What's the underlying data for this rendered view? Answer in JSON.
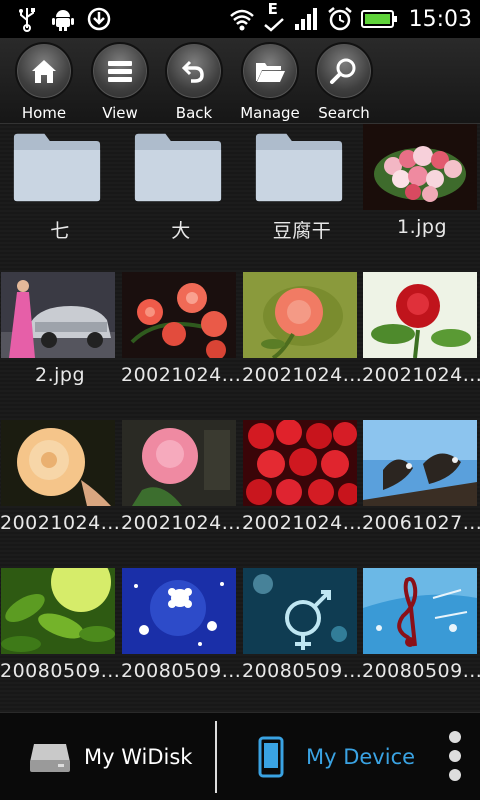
{
  "status_bar": {
    "time": "15:03",
    "network_letter": "E",
    "icons": [
      "usb-icon",
      "android-debug-icon",
      "download-icon",
      "wifi-icon",
      "signal-icon",
      "alarm-icon",
      "battery-icon"
    ]
  },
  "toolbar": {
    "buttons": [
      {
        "label": "Home",
        "icon": "home-icon"
      },
      {
        "label": "View",
        "icon": "list-view-icon"
      },
      {
        "label": "Back",
        "icon": "back-arrow-icon"
      },
      {
        "label": "Manage",
        "icon": "folder-open-icon"
      },
      {
        "label": "Search",
        "icon": "magnifier-icon"
      }
    ]
  },
  "items": [
    {
      "name": "七",
      "type": "folder"
    },
    {
      "name": "大",
      "type": "folder"
    },
    {
      "name": "豆腐干",
      "type": "folder"
    },
    {
      "name": "1.jpg",
      "type": "image",
      "thumb": "flower-bouquet"
    },
    {
      "name": "2.jpg",
      "type": "image",
      "thumb": "car-model"
    },
    {
      "name": "20021024...",
      "type": "image",
      "thumb": "red-roses"
    },
    {
      "name": "20021024...",
      "type": "image",
      "thumb": "pink-rose"
    },
    {
      "name": "20021024...",
      "type": "image",
      "thumb": "red-rose-single"
    },
    {
      "name": "20021024...",
      "type": "image",
      "thumb": "yellow-rose"
    },
    {
      "name": "20021024...",
      "type": "image",
      "thumb": "pink-rose-2"
    },
    {
      "name": "20021024...",
      "type": "image",
      "thumb": "red-roses-bunch"
    },
    {
      "name": "20061027...",
      "type": "image",
      "thumb": "eagles"
    },
    {
      "name": "20080509...",
      "type": "image",
      "thumb": "green-leaves"
    },
    {
      "name": "20080509...",
      "type": "image",
      "thumb": "blue-snowflakes"
    },
    {
      "name": "20080509...",
      "type": "image",
      "thumb": "symbol-swirl"
    },
    {
      "name": "20080509...",
      "type": "image",
      "thumb": "music-note"
    }
  ],
  "bottom_bar": {
    "left_label": "My WiDisk",
    "right_label": "My Device",
    "active": "My Device",
    "active_color": "#3aa3e3"
  }
}
